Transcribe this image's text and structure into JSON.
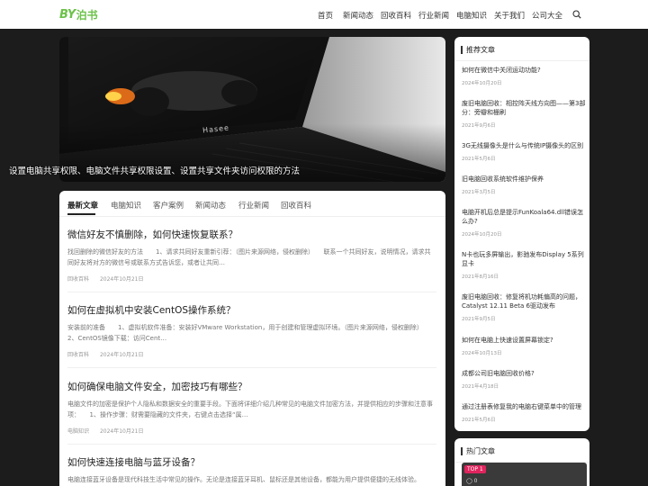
{
  "header": {
    "logo_mark": "BY",
    "logo_text": "泊书",
    "nav": [
      "首页",
      "新闻动态",
      "回收百科",
      "行业新闻",
      "电脑知识",
      "关于我们",
      "公司大全"
    ],
    "search_icon": "search-icon"
  },
  "hero": {
    "title": "设置电脑共享权限、电脑文件共享权限设置、设置共享文件夹访问权限的方法",
    "laptop_brand": "Hasee"
  },
  "tabs": [
    "最新文章",
    "电脑知识",
    "客户案例",
    "新闻动态",
    "行业新闻",
    "回收百科"
  ],
  "articles": [
    {
      "title": "微信好友不慎删除，如何快速恢复联系？",
      "excerpt": "找回删除的微信好友的方法　　1、请求共同好友重新引荐：（图片来源网络，侵权删除）　　联系一个共同好友，说明情况，请求共同好友将对方的微信号或联系方式告诉您，或者让共同…",
      "category": "回收百科",
      "date": "2024年10月21日"
    },
    {
      "title": "如何在虚拟机中安装CentOS操作系统？",
      "excerpt": "安装前的准备　　1、虚拟机软件准备：安装好VMware Workstation，用于创建和管理虚拟环境。（图片来源网络，侵权删除）　　2、CentOS镜像下载：访问Cent…",
      "category": "回收百科",
      "date": "2024年10月21日"
    },
    {
      "title": "如何确保电脑文件安全，加密技巧有哪些？",
      "excerpt": "电脑文件的加密是保护个人隐私和数据安全的重要手段。下面将详细介绍几种常见的电脑文件加密方法，并提供相应的步骤和注意事项：　　1、操作步骤：财需要隐藏的文件夹，右键点击选择“属…",
      "category": "电脑知识",
      "date": "2024年10月21日"
    },
    {
      "title": "如何快速连接电脑与蓝牙设备？",
      "excerpt": "电脑连接蓝牙设备是现代科技生活中常见的操作。无论是连接蓝牙耳机、鼠标还是其他设备，都能为用户提供便捷的无线体验。",
      "category": "",
      "date": ""
    }
  ],
  "sidebar": {
    "recommended_title": "推荐文章",
    "recommended": [
      {
        "title": "如何在微信中关闭运动功能?",
        "date": "2024年10月20日"
      },
      {
        "title": "废旧电脑回收：相控阵天线方向图——第3部分：旁瓣和栅刷",
        "date": "2021年9月6日"
      },
      {
        "title": "3G无线摄像头是什么与传统IP摄像头的区别",
        "date": "2021年5月6日"
      },
      {
        "title": "旧电脑回收系统软件维护保养",
        "date": "2021年3月5日"
      },
      {
        "title": "电脑开机后总是提示FunKoala64.dll错误怎么办?",
        "date": "2024年10月20日"
      },
      {
        "title": "N卡也玩多屏输出，影驰发布Display 5系列显卡",
        "date": "2021年8月16日"
      },
      {
        "title": "废旧电脑回收：修复将机功耗偏高的问题，Catalyst 12.11 Beta 6驱动发布",
        "date": "2021年9月5日"
      },
      {
        "title": "如何在电脑上快速设置屏幕锁定?",
        "date": "2024年10月13日"
      },
      {
        "title": "成都公司旧电脑回收价格?",
        "date": "2021年4月18日"
      },
      {
        "title": "通过注册表修复我的电脑右键菜单中的管理",
        "date": "2021年5月6日"
      }
    ],
    "hot_title": "热门文章",
    "hot_badge": "TOP 1",
    "hot_views": "0"
  }
}
